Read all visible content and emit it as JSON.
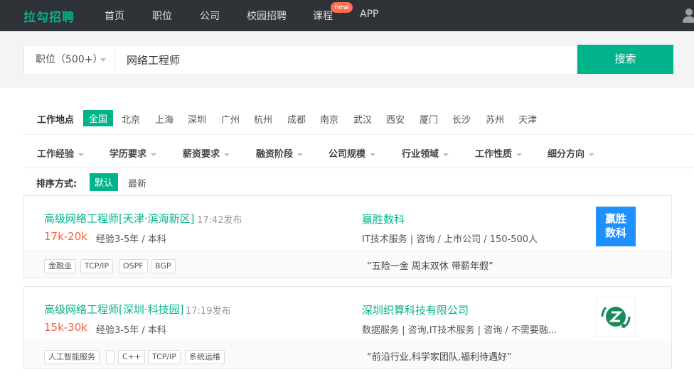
{
  "header": {
    "logo": "拉勾招聘",
    "nav": [
      "首页",
      "职位",
      "公司",
      "校园招聘",
      "课程",
      "APP"
    ],
    "new_badge": "new"
  },
  "search": {
    "type_label": "职位（500+）",
    "query": "网络工程师",
    "button": "搜索"
  },
  "filters": {
    "location_label": "工作地点",
    "cities": [
      "全国",
      "北京",
      "上海",
      "深圳",
      "广州",
      "杭州",
      "成都",
      "南京",
      "武汉",
      "西安",
      "厦门",
      "长沙",
      "苏州",
      "天津"
    ],
    "dropdowns": [
      "工作经验",
      "学历要求",
      "薪资要求",
      "融资阶段",
      "公司规模",
      "行业领域",
      "工作性质",
      "细分方向"
    ],
    "sort_label": "排序方式:",
    "sort_options": [
      "默认",
      "最新"
    ]
  },
  "jobs": [
    {
      "title": "高级网络工程师[天津·滨海新区]",
      "time": "17:42发布",
      "salary": "17k-20k",
      "requirement": "经验3-5年 / 本科",
      "company": "赢胜数科",
      "industry": "IT技术服务 | 咨询 / 上市公司 / 150-500人",
      "logo_text": [
        "赢胜",
        "数科"
      ],
      "logo_color": "#1e90ff",
      "tags": [
        "金融业",
        "TCP/IP",
        "OSPF",
        "BGP"
      ],
      "benefit": "“五险一金 周末双休 带薪年假”"
    },
    {
      "title": "高级网络工程师[深圳·科技园]",
      "time": "17:19发布",
      "salary": "15k-30k",
      "requirement": "经验3-5年 / 本科",
      "company": "深圳织算科技有限公司",
      "industry": "数据服务 | 咨询,IT技术服务 | 咨询 / 不需要融...",
      "logo_icon": "zhisuan-logo-icon",
      "logo_color": "#1a8a5a",
      "tags": [
        "人工智能服务",
        "",
        "C++",
        "TCP/IP",
        "系统运维"
      ],
      "benefit": "“前沿行业,科学家团队,福利待遇好”"
    }
  ]
}
